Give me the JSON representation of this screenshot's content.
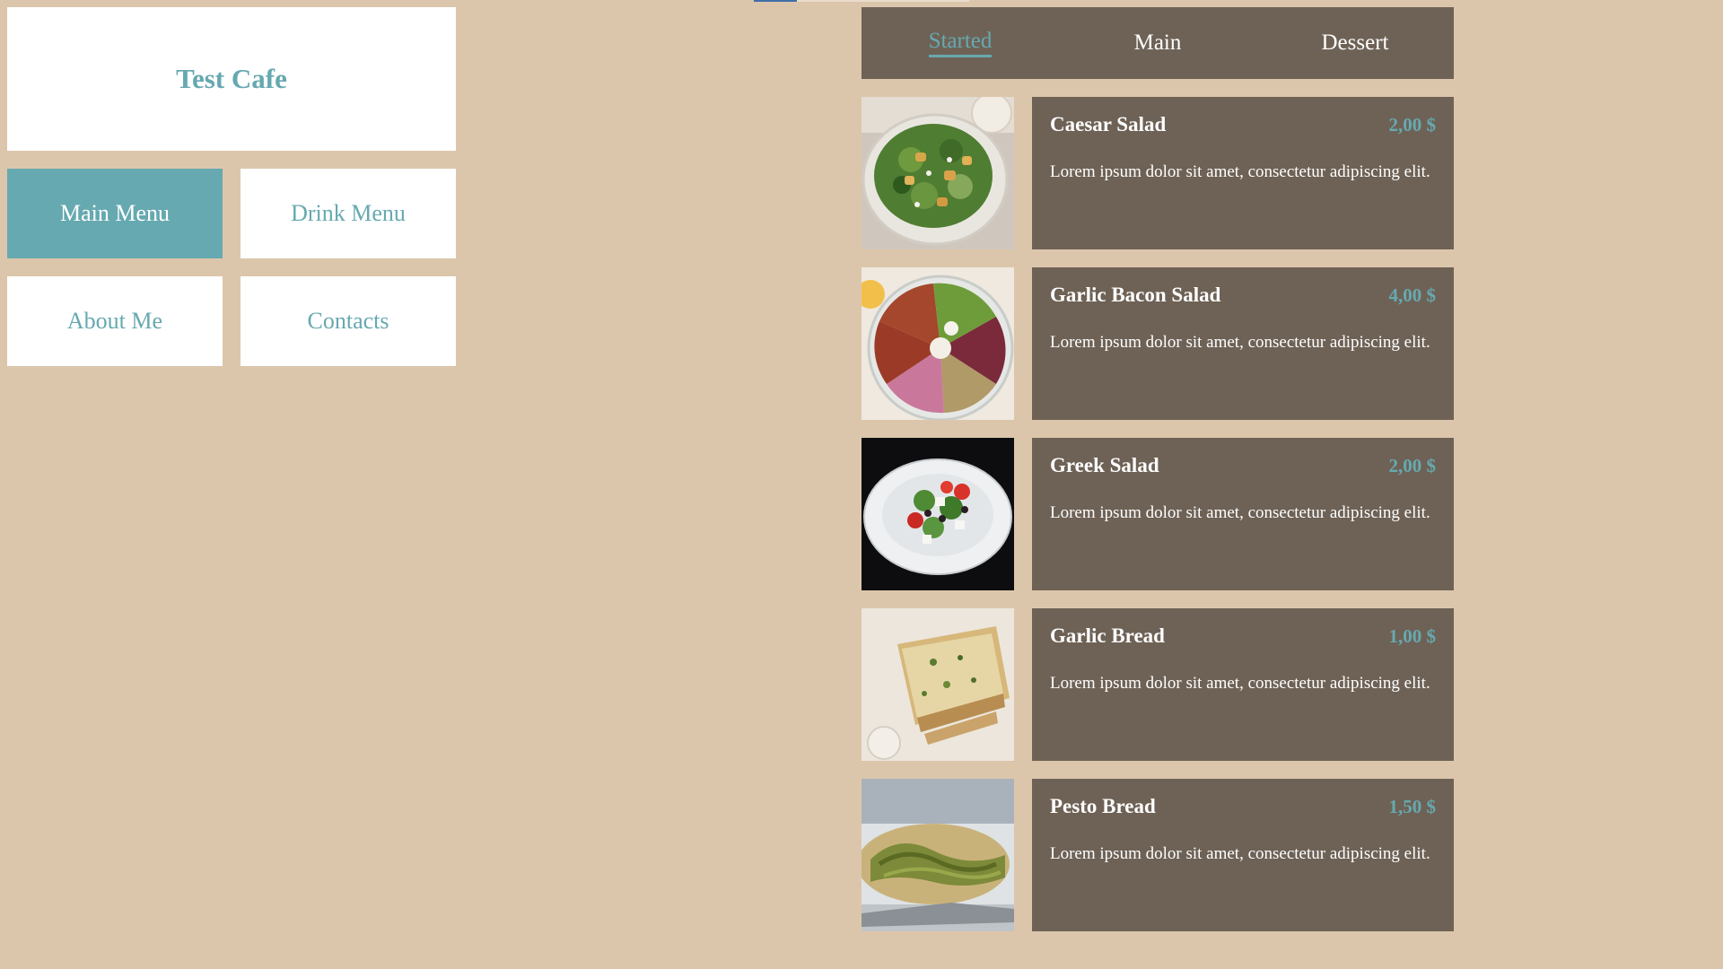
{
  "brand": {
    "title": "Test Cafe"
  },
  "nav": {
    "main_menu": "Main Menu",
    "drink_menu": "Drink Menu",
    "about_me": "About Me",
    "contacts": "Contacts"
  },
  "tabs": [
    {
      "label": "Started",
      "active": true
    },
    {
      "label": "Main",
      "active": false
    },
    {
      "label": "Dessert",
      "active": false
    }
  ],
  "items": [
    {
      "name": "Caesar Salad",
      "price": "2,00 $",
      "desc": "Lorem ipsum dolor sit amet, consectetur adipiscing elit.",
      "image": "caesar-salad-photo"
    },
    {
      "name": "Garlic Bacon Salad",
      "price": "4,00 $",
      "desc": "Lorem ipsum dolor sit amet, consectetur adipiscing elit.",
      "image": "garlic-bacon-salad-photo"
    },
    {
      "name": "Greek Salad",
      "price": "2,00 $",
      "desc": "Lorem ipsum dolor sit amet, consectetur adipiscing elit.",
      "image": "greek-salad-photo"
    },
    {
      "name": "Garlic Bread",
      "price": "1,00 $",
      "desc": "Lorem ipsum dolor sit amet, consectetur adipiscing elit.",
      "image": "garlic-bread-photo"
    },
    {
      "name": "Pesto Bread",
      "price": "1,50 $",
      "desc": "Lorem ipsum dolor sit amet, consectetur adipiscing elit.",
      "image": "pesto-bread-photo"
    }
  ],
  "colors": {
    "background": "#dcc6ab",
    "accent": "#66a9b0",
    "card": "#6e6256",
    "white": "#ffffff"
  }
}
